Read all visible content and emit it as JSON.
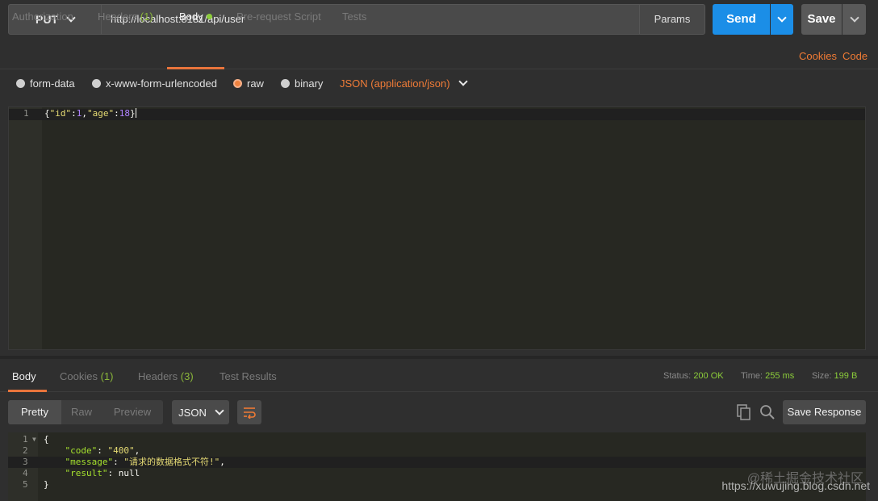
{
  "request": {
    "method": "PUT",
    "url": "http://localhost:8181/api/user",
    "params_label": "Params",
    "send_label": "Send",
    "save_label": "Save"
  },
  "request_tabs": {
    "authorization": "Authorization",
    "headers": "Headers",
    "headers_count": "(1)",
    "body": "Body",
    "pre_request": "Pre-request Script",
    "tests": "Tests",
    "cookies": "Cookies",
    "code": "Code"
  },
  "body_types": {
    "form_data": "form-data",
    "urlencoded": "x-www-form-urlencoded",
    "raw": "raw",
    "binary": "binary",
    "selected": "raw",
    "content_type": "JSON (application/json)"
  },
  "request_editor": {
    "line_number": "1",
    "brace_open": "{",
    "key_id": "\"id\"",
    "colon1": ":",
    "val_id": "1",
    "comma": ",",
    "key_age": "\"age\"",
    "colon2": ":",
    "val_age": "18",
    "brace_close": "}"
  },
  "response_tabs": {
    "body": "Body",
    "cookies": "Cookies",
    "cookies_count": "(1)",
    "headers": "Headers",
    "headers_count": "(3)",
    "test_results": "Test Results"
  },
  "response_meta": {
    "status_label": "Status:",
    "status_value": "200 OK",
    "time_label": "Time:",
    "time_value": "255 ms",
    "size_label": "Size:",
    "size_value": "199 B"
  },
  "response_toolbar": {
    "pretty": "Pretty",
    "raw": "Raw",
    "preview": "Preview",
    "format": "JSON",
    "save_response": "Save Response"
  },
  "response_body": {
    "lines": [
      {
        "n": "1",
        "text": "{"
      },
      {
        "n": "2",
        "key": "\"code\"",
        "sep": ": ",
        "val": "\"400\"",
        "end": ","
      },
      {
        "n": "3",
        "key": "\"message\"",
        "sep": ": ",
        "val": "\"请求的数据格式不符!\"",
        "end": ","
      },
      {
        "n": "4",
        "key": "\"result\"",
        "sep": ": ",
        "val": "null",
        "end": ""
      },
      {
        "n": "5",
        "text": "}"
      }
    ]
  },
  "watermark": {
    "top": "@稀土掘金技术社区",
    "bottom": "https://xuwujing.blog.csdn.net"
  },
  "colors": {
    "accent_orange": "#e8743b",
    "send_blue": "#1b8ee7",
    "status_green": "#8ccd3a"
  }
}
